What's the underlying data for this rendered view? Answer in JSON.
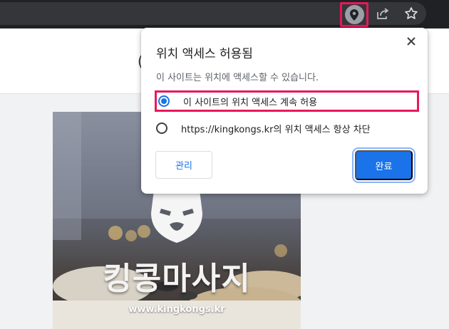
{
  "toolbar": {
    "location_icon": "location-pin-icon",
    "share_icon": "share-icon",
    "bookmark_icon": "star-icon"
  },
  "page": {
    "header_partial_char": "(",
    "hero_title": "킹콩마사지",
    "hero_url": "www.kingkongs.kr"
  },
  "popup": {
    "title": "위치 액세스 허용됨",
    "description": "이 사이트는 위치에 액세스할 수 있습니다.",
    "options": [
      {
        "label": "이 사이트의 위치 액세스 계속 허용",
        "selected": true
      },
      {
        "label": "https://kingkongs.kr의 위치 액세스 항상 차단",
        "selected": false
      }
    ],
    "manage_label": "관리",
    "done_label": "완료",
    "close_icon": "close-icon"
  },
  "colors": {
    "accent": "#1a73e8",
    "highlight": "#e8185a",
    "toolbar_bg": "#202124"
  }
}
